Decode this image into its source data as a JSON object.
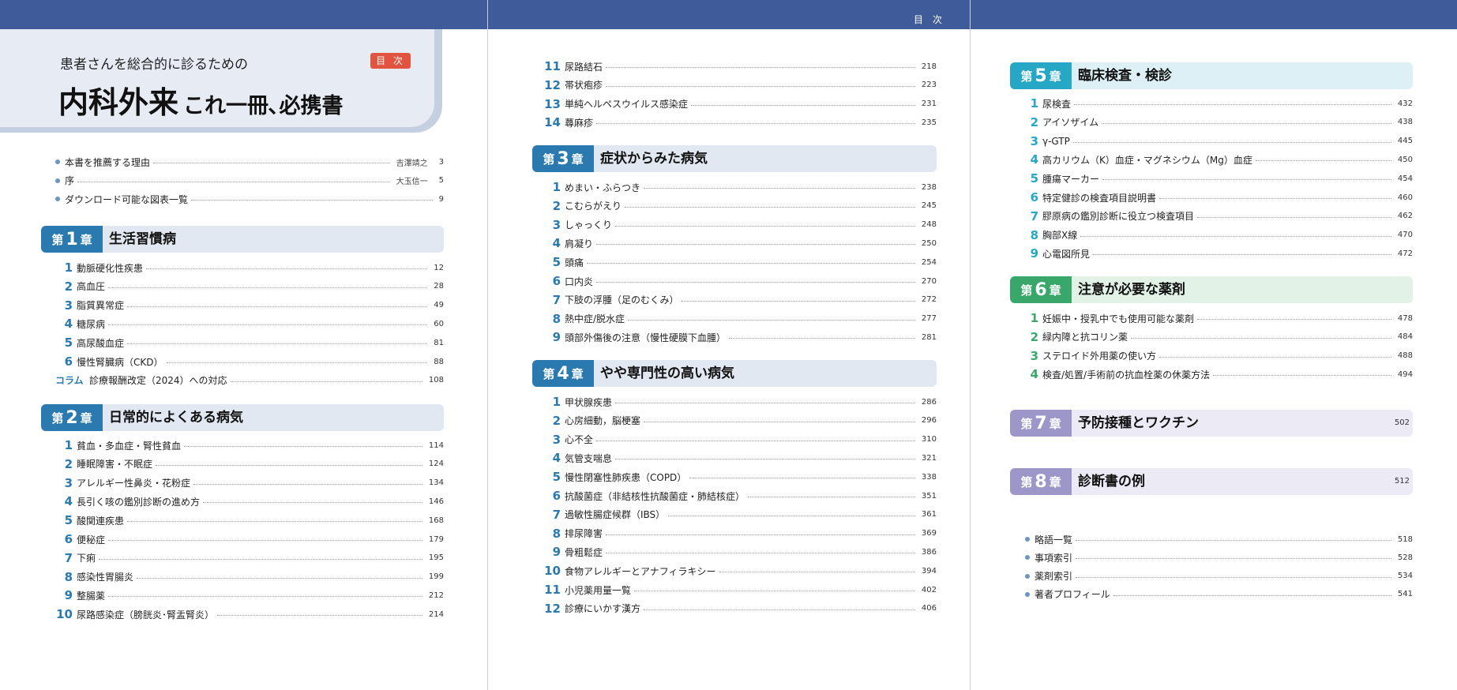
{
  "header": {
    "label": "目 次"
  },
  "title": {
    "subtitle": "患者さんを総合的に診るための",
    "main_big": "内科外来",
    "main_small": "これ一冊､必携書",
    "badge": "目 次"
  },
  "colors": {
    "header_bar": "#3f5b99",
    "blue": "#2a7ab0",
    "cyan": "#27a7c6",
    "green": "#3aa76a",
    "purple": "#9c97c8",
    "badge": "#e2543f"
  },
  "front": [
    {
      "text": "本書を推薦する理由",
      "author": "吉澤靖之",
      "page": "3"
    },
    {
      "text": "序",
      "author": "大玉信一",
      "page": "5"
    },
    {
      "text": "ダウンロード可能な図表一覧",
      "author": "",
      "page": "9"
    }
  ],
  "chapters": [
    {
      "prefix": "第",
      "num": "1",
      "suffix": "章",
      "title": "生活習慣病",
      "page": "",
      "items": [
        {
          "n": "1",
          "t": "動脈硬化性疾患",
          "p": "12"
        },
        {
          "n": "2",
          "t": "高血圧",
          "p": "28"
        },
        {
          "n": "3",
          "t": "脂質異常症",
          "p": "49"
        },
        {
          "n": "4",
          "t": "糖尿病",
          "p": "60"
        },
        {
          "n": "5",
          "t": "高尿酸血症",
          "p": "81"
        },
        {
          "n": "6",
          "t": "慢性腎臓病（CKD）",
          "p": "88"
        },
        {
          "n": "コラム",
          "t": "診療報酬改定（2024）への対応",
          "p": "108"
        }
      ]
    },
    {
      "prefix": "第",
      "num": "2",
      "suffix": "章",
      "title": "日常的によくある病気",
      "page": "",
      "items": [
        {
          "n": "1",
          "t": "貧血・多血症・腎性貧血",
          "p": "114"
        },
        {
          "n": "2",
          "t": "睡眠障害・不眠症",
          "p": "124"
        },
        {
          "n": "3",
          "t": "アレルギー性鼻炎・花粉症",
          "p": "134"
        },
        {
          "n": "4",
          "t": "長引く咳の鑑別診断の進め方",
          "p": "146"
        },
        {
          "n": "5",
          "t": "酸関連疾患",
          "p": "168"
        },
        {
          "n": "6",
          "t": "便秘症",
          "p": "179"
        },
        {
          "n": "7",
          "t": "下痢",
          "p": "195"
        },
        {
          "n": "8",
          "t": "感染性胃腸炎",
          "p": "199"
        },
        {
          "n": "9",
          "t": "整腸薬",
          "p": "212"
        },
        {
          "n": "10",
          "t": "尿路感染症（膀胱炎･腎盂腎炎）",
          "p": "214"
        },
        {
          "n": "11",
          "t": "尿路結石",
          "p": "218"
        },
        {
          "n": "12",
          "t": "帯状疱疹",
          "p": "223"
        },
        {
          "n": "13",
          "t": "単純ヘルペスウイルス感染症",
          "p": "231"
        },
        {
          "n": "14",
          "t": "蕁麻疹",
          "p": "235"
        }
      ]
    },
    {
      "prefix": "第",
      "num": "3",
      "suffix": "章",
      "title": "症状からみた病気",
      "page": "",
      "items": [
        {
          "n": "1",
          "t": "めまい・ふらつき",
          "p": "238"
        },
        {
          "n": "2",
          "t": "こむらがえり",
          "p": "245"
        },
        {
          "n": "3",
          "t": "しゃっくり",
          "p": "248"
        },
        {
          "n": "4",
          "t": "肩凝り",
          "p": "250"
        },
        {
          "n": "5",
          "t": "頭痛",
          "p": "254"
        },
        {
          "n": "6",
          "t": "口内炎",
          "p": "270"
        },
        {
          "n": "7",
          "t": "下肢の浮腫（足のむくみ）",
          "p": "272"
        },
        {
          "n": "8",
          "t": "熱中症/脱水症",
          "p": "277"
        },
        {
          "n": "9",
          "t": "頭部外傷後の注意（慢性硬膜下血腫）",
          "p": "281"
        }
      ]
    },
    {
      "prefix": "第",
      "num": "4",
      "suffix": "章",
      "title": "やや専門性の高い病気",
      "page": "",
      "items": [
        {
          "n": "1",
          "t": "甲状腺疾患",
          "p": "286"
        },
        {
          "n": "2",
          "t": "心房細動，脳梗塞",
          "p": "296"
        },
        {
          "n": "3",
          "t": "心不全",
          "p": "310"
        },
        {
          "n": "4",
          "t": "気管支喘息",
          "p": "321"
        },
        {
          "n": "5",
          "t": "慢性閉塞性肺疾患（COPD）",
          "p": "338"
        },
        {
          "n": "6",
          "t": "抗酸菌症（非結核性抗酸菌症・肺結核症）",
          "p": "351"
        },
        {
          "n": "7",
          "t": "過敏性腸症候群（IBS）",
          "p": "361"
        },
        {
          "n": "8",
          "t": "排尿障害",
          "p": "369"
        },
        {
          "n": "9",
          "t": "骨粗鬆症",
          "p": "386"
        },
        {
          "n": "10",
          "t": "食物アレルギーとアナフィラキシー",
          "p": "394"
        },
        {
          "n": "11",
          "t": "小児薬用量一覧",
          "p": "402"
        },
        {
          "n": "12",
          "t": "診療にいかす漢方",
          "p": "406"
        }
      ]
    },
    {
      "prefix": "第",
      "num": "5",
      "suffix": "章",
      "title": "臨床検査・検診",
      "page": "",
      "items": [
        {
          "n": "1",
          "t": "尿検査",
          "p": "432"
        },
        {
          "n": "2",
          "t": "アイソザイム",
          "p": "438"
        },
        {
          "n": "3",
          "t": "γ-GTP",
          "p": "445"
        },
        {
          "n": "4",
          "t": "高カリウム（K）血症・マグネシウム（Mg）血症",
          "p": "450"
        },
        {
          "n": "5",
          "t": "腫瘍マーカー",
          "p": "454"
        },
        {
          "n": "6",
          "t": "特定健診の検査項目説明書",
          "p": "460"
        },
        {
          "n": "7",
          "t": "膠原病の鑑別診断に役立つ検査項目",
          "p": "462"
        },
        {
          "n": "8",
          "t": "胸部X線",
          "p": "470"
        },
        {
          "n": "9",
          "t": "心電図所見",
          "p": "472"
        }
      ]
    },
    {
      "prefix": "第",
      "num": "6",
      "suffix": "章",
      "title": "注意が必要な薬剤",
      "page": "",
      "items": [
        {
          "n": "1",
          "t": "妊娠中・授乳中でも使用可能な薬剤",
          "p": "478"
        },
        {
          "n": "2",
          "t": "緑内障と抗コリン薬",
          "p": "484"
        },
        {
          "n": "3",
          "t": "ステロイド外用薬の使い方",
          "p": "488"
        },
        {
          "n": "4",
          "t": "検査/処置/手術前の抗血栓薬の休薬方法",
          "p": "494"
        }
      ]
    },
    {
      "prefix": "第",
      "num": "7",
      "suffix": "章",
      "title": "予防接種とワクチン",
      "page": "502",
      "items": []
    },
    {
      "prefix": "第",
      "num": "8",
      "suffix": "章",
      "title": "診断書の例",
      "page": "512",
      "items": []
    }
  ],
  "back": [
    {
      "text": "略語一覧",
      "page": "518"
    },
    {
      "text": "事項索引",
      "page": "528"
    },
    {
      "text": "薬剤索引",
      "page": "534"
    },
    {
      "text": "著者プロフィール",
      "page": "541"
    }
  ]
}
